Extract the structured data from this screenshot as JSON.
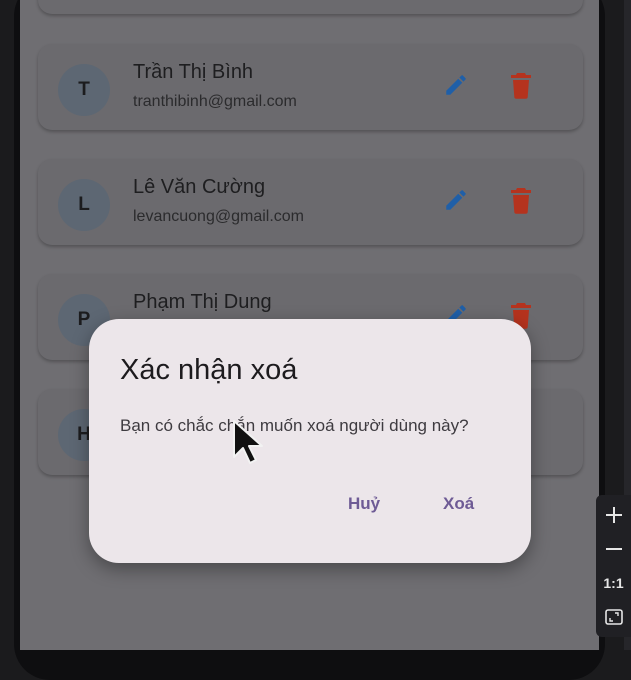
{
  "users": [
    {
      "initial": "T",
      "name": "Trần Thị Bình",
      "email": "tranthibinh@gmail.com"
    },
    {
      "initial": "L",
      "name": "Lê Văn Cường",
      "email": "levancuong@gmail.com"
    },
    {
      "initial": "P",
      "name": "Phạm Thị Dung",
      "email": ""
    },
    {
      "initial": "H",
      "name": "",
      "email": ""
    }
  ],
  "dialog": {
    "title": "Xác nhận xoá",
    "message": "Bạn có chắc chắn muốn xoá người dùng này?",
    "cancel_label": "Huỷ",
    "confirm_label": "Xoá"
  },
  "zoom_toolbar": {
    "zoom_in_icon": "plus-icon",
    "zoom_out_icon": "minus-icon",
    "actual_size_label": "1:1",
    "fit_icon": "fit-screen-icon"
  },
  "colors": {
    "edit_icon": "#1f5fa8",
    "delete_icon": "#b5331e",
    "dialog_button": "#6e5b95"
  }
}
